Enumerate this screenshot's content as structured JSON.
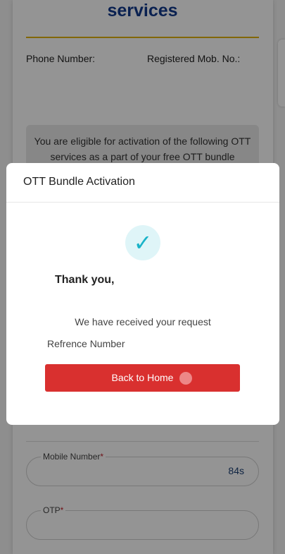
{
  "background_page": {
    "title": "services",
    "phone_number_label": "Phone Number:",
    "registered_mobile_label": "Registered Mob. No.:",
    "eligibility_text": "You are eligible for activation of the following OTT services as a part of your free OTT bundle",
    "mobile_field": {
      "label": "Mobile Number",
      "required_mark": "*",
      "timer": "84s"
    },
    "otp_field": {
      "label": "OTP",
      "required_mark": "*"
    }
  },
  "modal": {
    "title": "OTT Bundle Activation",
    "success_icon": "checkmark-icon",
    "success_glyph": "✓",
    "thanks_text": "Thank you,",
    "received_text": "We have received your request",
    "reference_label": "Refrence Number",
    "back_button_label": "Back to Home"
  },
  "colors": {
    "title_blue": "#123a8c",
    "accent_gold": "#e1b100",
    "button_red": "#d9302f",
    "check_teal": "#19b3c8"
  }
}
